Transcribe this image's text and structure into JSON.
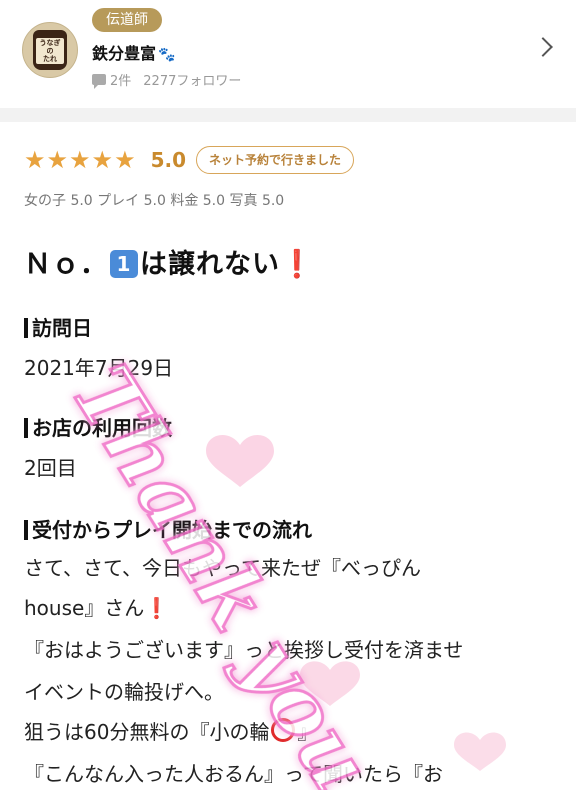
{
  "header": {
    "avatar_lines": [
      "うなぎ",
      "の",
      "たれ"
    ],
    "rank_badge": "伝道師",
    "user_name": "鉄分豊富",
    "paw": "🐾",
    "review_count": "2件",
    "followers": "2277フォロワー"
  },
  "rating": {
    "stars": "★★★★★",
    "score": "5.0",
    "visit_badge": "ネット予約で行きました",
    "subscores": "女の子 5.0 プレイ 5.0 料金 5.0 写真 5.0"
  },
  "review": {
    "title_a": "Ｎｏ．",
    "title_num": "1",
    "title_b": "は譲れない",
    "title_mark": "❗",
    "visit_date_head": "訪問日",
    "visit_date": "2021年7月29日",
    "use_count_head": "お店の利用回数",
    "use_count": "2回目",
    "flow_head": "受付からプレイ開始までの流れ",
    "line1": "さて、さて、今日もやって来たぜ『べっぴん",
    "line2a": "house』さん",
    "line2b": "❗",
    "line3": "『おはようございます』っと挨拶し受付を済ませ",
    "line4": "イベントの輪投げへ。",
    "line5a": "狙うは60分無料の『小の輪",
    "line5b": "』",
    "line6": "『こんなん入った人おるん』って聞いたら『お"
  },
  "watermark": {
    "text": "Thank you"
  },
  "colors": {
    "star": "#e8a33f",
    "badge_gold": "#b79a5a",
    "accent_red": "#e02a2a",
    "watermark_pink": "#f7a8d8"
  }
}
